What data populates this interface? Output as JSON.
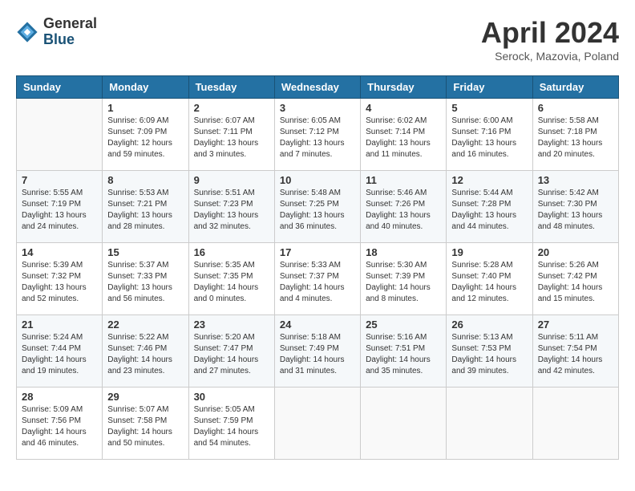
{
  "header": {
    "logo_general": "General",
    "logo_blue": "Blue",
    "month_title": "April 2024",
    "subtitle": "Serock, Mazovia, Poland"
  },
  "days_of_week": [
    "Sunday",
    "Monday",
    "Tuesday",
    "Wednesday",
    "Thursday",
    "Friday",
    "Saturday"
  ],
  "weeks": [
    [
      {
        "day": "",
        "info": ""
      },
      {
        "day": "1",
        "info": "Sunrise: 6:09 AM\nSunset: 7:09 PM\nDaylight: 12 hours\nand 59 minutes."
      },
      {
        "day": "2",
        "info": "Sunrise: 6:07 AM\nSunset: 7:11 PM\nDaylight: 13 hours\nand 3 minutes."
      },
      {
        "day": "3",
        "info": "Sunrise: 6:05 AM\nSunset: 7:12 PM\nDaylight: 13 hours\nand 7 minutes."
      },
      {
        "day": "4",
        "info": "Sunrise: 6:02 AM\nSunset: 7:14 PM\nDaylight: 13 hours\nand 11 minutes."
      },
      {
        "day": "5",
        "info": "Sunrise: 6:00 AM\nSunset: 7:16 PM\nDaylight: 13 hours\nand 16 minutes."
      },
      {
        "day": "6",
        "info": "Sunrise: 5:58 AM\nSunset: 7:18 PM\nDaylight: 13 hours\nand 20 minutes."
      }
    ],
    [
      {
        "day": "7",
        "info": "Sunrise: 5:55 AM\nSunset: 7:19 PM\nDaylight: 13 hours\nand 24 minutes."
      },
      {
        "day": "8",
        "info": "Sunrise: 5:53 AM\nSunset: 7:21 PM\nDaylight: 13 hours\nand 28 minutes."
      },
      {
        "day": "9",
        "info": "Sunrise: 5:51 AM\nSunset: 7:23 PM\nDaylight: 13 hours\nand 32 minutes."
      },
      {
        "day": "10",
        "info": "Sunrise: 5:48 AM\nSunset: 7:25 PM\nDaylight: 13 hours\nand 36 minutes."
      },
      {
        "day": "11",
        "info": "Sunrise: 5:46 AM\nSunset: 7:26 PM\nDaylight: 13 hours\nand 40 minutes."
      },
      {
        "day": "12",
        "info": "Sunrise: 5:44 AM\nSunset: 7:28 PM\nDaylight: 13 hours\nand 44 minutes."
      },
      {
        "day": "13",
        "info": "Sunrise: 5:42 AM\nSunset: 7:30 PM\nDaylight: 13 hours\nand 48 minutes."
      }
    ],
    [
      {
        "day": "14",
        "info": "Sunrise: 5:39 AM\nSunset: 7:32 PM\nDaylight: 13 hours\nand 52 minutes."
      },
      {
        "day": "15",
        "info": "Sunrise: 5:37 AM\nSunset: 7:33 PM\nDaylight: 13 hours\nand 56 minutes."
      },
      {
        "day": "16",
        "info": "Sunrise: 5:35 AM\nSunset: 7:35 PM\nDaylight: 14 hours\nand 0 minutes."
      },
      {
        "day": "17",
        "info": "Sunrise: 5:33 AM\nSunset: 7:37 PM\nDaylight: 14 hours\nand 4 minutes."
      },
      {
        "day": "18",
        "info": "Sunrise: 5:30 AM\nSunset: 7:39 PM\nDaylight: 14 hours\nand 8 minutes."
      },
      {
        "day": "19",
        "info": "Sunrise: 5:28 AM\nSunset: 7:40 PM\nDaylight: 14 hours\nand 12 minutes."
      },
      {
        "day": "20",
        "info": "Sunrise: 5:26 AM\nSunset: 7:42 PM\nDaylight: 14 hours\nand 15 minutes."
      }
    ],
    [
      {
        "day": "21",
        "info": "Sunrise: 5:24 AM\nSunset: 7:44 PM\nDaylight: 14 hours\nand 19 minutes."
      },
      {
        "day": "22",
        "info": "Sunrise: 5:22 AM\nSunset: 7:46 PM\nDaylight: 14 hours\nand 23 minutes."
      },
      {
        "day": "23",
        "info": "Sunrise: 5:20 AM\nSunset: 7:47 PM\nDaylight: 14 hours\nand 27 minutes."
      },
      {
        "day": "24",
        "info": "Sunrise: 5:18 AM\nSunset: 7:49 PM\nDaylight: 14 hours\nand 31 minutes."
      },
      {
        "day": "25",
        "info": "Sunrise: 5:16 AM\nSunset: 7:51 PM\nDaylight: 14 hours\nand 35 minutes."
      },
      {
        "day": "26",
        "info": "Sunrise: 5:13 AM\nSunset: 7:53 PM\nDaylight: 14 hours\nand 39 minutes."
      },
      {
        "day": "27",
        "info": "Sunrise: 5:11 AM\nSunset: 7:54 PM\nDaylight: 14 hours\nand 42 minutes."
      }
    ],
    [
      {
        "day": "28",
        "info": "Sunrise: 5:09 AM\nSunset: 7:56 PM\nDaylight: 14 hours\nand 46 minutes."
      },
      {
        "day": "29",
        "info": "Sunrise: 5:07 AM\nSunset: 7:58 PM\nDaylight: 14 hours\nand 50 minutes."
      },
      {
        "day": "30",
        "info": "Sunrise: 5:05 AM\nSunset: 7:59 PM\nDaylight: 14 hours\nand 54 minutes."
      },
      {
        "day": "",
        "info": ""
      },
      {
        "day": "",
        "info": ""
      },
      {
        "day": "",
        "info": ""
      },
      {
        "day": "",
        "info": ""
      }
    ]
  ]
}
